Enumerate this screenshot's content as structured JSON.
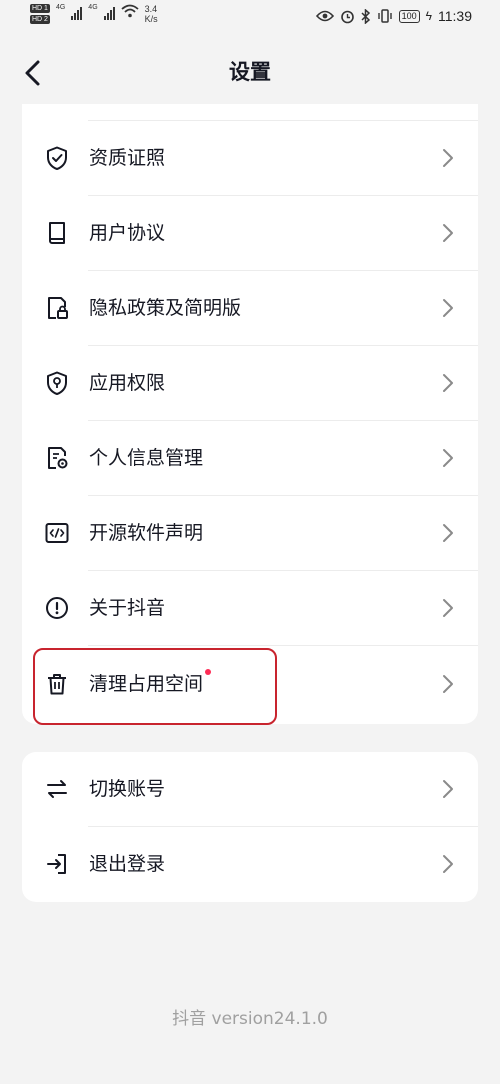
{
  "status_bar": {
    "sim1": "HD 1",
    "sim2": "HD 2",
    "network1": "4G",
    "network2": "4G",
    "speed_value": "3.4",
    "speed_unit": "K/s",
    "battery": "100",
    "time": "11:39"
  },
  "header": {
    "back_icon": "chevron-left-icon",
    "title": "设置"
  },
  "settings_group_1": {
    "items": [
      {
        "label": "资质证照",
        "icon": "shield-check-icon"
      },
      {
        "label": "用户协议",
        "icon": "book-icon"
      },
      {
        "label": "隐私政策及简明版",
        "icon": "document-lock-icon"
      },
      {
        "label": "应用权限",
        "icon": "shield-permission-icon"
      },
      {
        "label": "个人信息管理",
        "icon": "document-gear-icon"
      },
      {
        "label": "开源软件声明",
        "icon": "code-icon"
      },
      {
        "label": "关于抖音",
        "icon": "info-exclamation-icon"
      },
      {
        "label": "清理占用空间",
        "icon": "trash-icon",
        "badge": "red-dot"
      }
    ]
  },
  "settings_group_2": {
    "items": [
      {
        "label": "切换账号",
        "icon": "switch-arrows-icon"
      },
      {
        "label": "退出登录",
        "icon": "logout-icon"
      }
    ]
  },
  "footer": {
    "version": "抖音 version24.1.0"
  },
  "colors": {
    "background": "#f3f3f3",
    "card": "#ffffff",
    "text": "#161823",
    "chevron": "#8a8a8a",
    "badge": "#fe2c55",
    "highlight": "#c8242e"
  }
}
